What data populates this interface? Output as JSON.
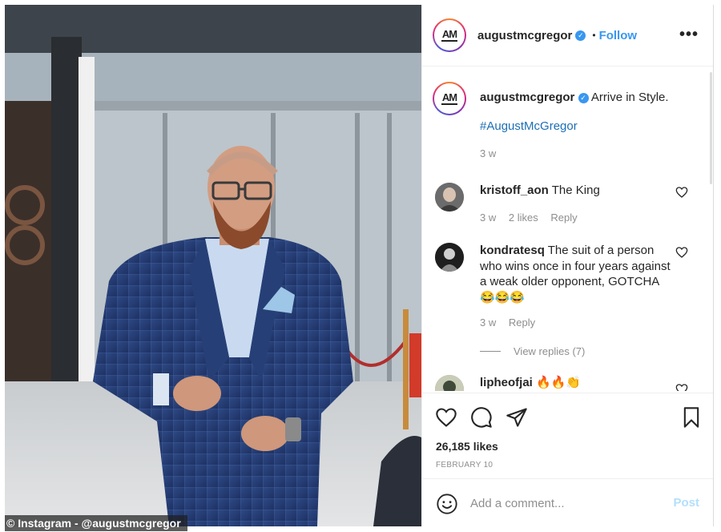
{
  "photo": {
    "alt": "Man in a blue checked suit with glasses walking through a glass-walled lobby",
    "credit": "© Instagram - @augustmcgregor"
  },
  "header": {
    "username": "augustmcgregor",
    "verified_icon": "verified-check-icon",
    "separator": "•",
    "follow_label": "Follow",
    "more_label": "•••",
    "avatar_text": "AM"
  },
  "caption": {
    "username": "augustmcgregor",
    "text": "Arrive in Style.",
    "hashtag": "#AugustMcGregor",
    "time": "3 w"
  },
  "comments": [
    {
      "username": "kristoff_aon",
      "text": "The King",
      "time": "3 w",
      "likes": "2 likes",
      "reply": "Reply"
    },
    {
      "username": "kondratesq",
      "text": "The suit of a person who wins once in four years against a weak older opponent, GOTCHA 😂😂😂",
      "time": "3 w",
      "reply": "Reply",
      "view_replies": "View replies (7)"
    },
    {
      "username": "lipheofjai",
      "text": "🔥🔥👏"
    }
  ],
  "actions": {
    "icons": [
      "heart-icon",
      "comment-icon",
      "share-icon",
      "bookmark-icon"
    ],
    "likes": "26,185 likes",
    "date": "FEBRUARY 10"
  },
  "add_comment": {
    "placeholder": "Add a comment...",
    "post_label": "Post"
  },
  "colors": {
    "link_blue": "#3897f0",
    "hashtag_blue": "#1d6fb5",
    "muted": "#8e8e8e",
    "post_disabled": "#b2dffc"
  }
}
